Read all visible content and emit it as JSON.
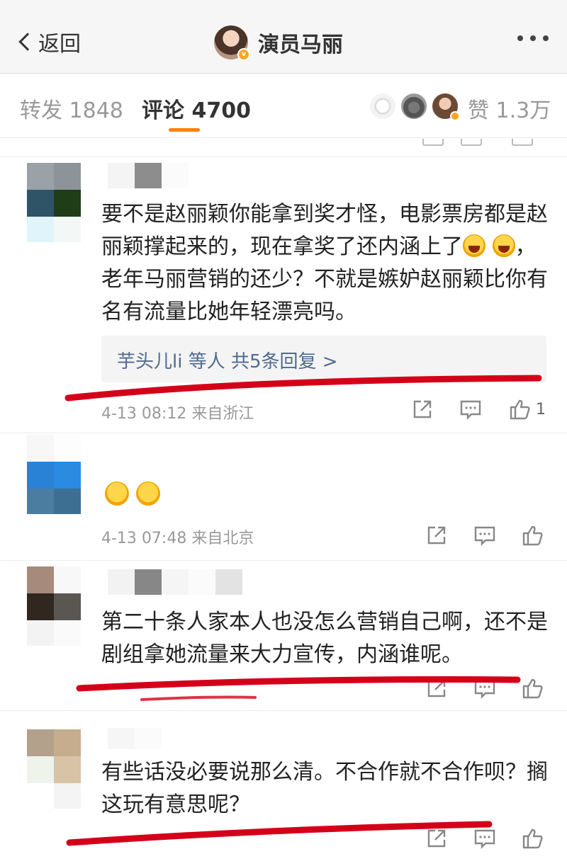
{
  "header": {
    "back_label": "返回",
    "title": "演员马丽",
    "verified_badge": "v"
  },
  "tabs": {
    "repost_label": "转发 1848",
    "comment_label": "评论 4700",
    "likes_label": "赞 1.3万"
  },
  "comments": [
    {
      "text_parts": [
        "要不是赵丽颖你能拿到奖才怪，电影票房都是赵丽颖撑起来的，现在拿奖了还内涵上了",
        "，老年马丽营销的还少？不就是嫉妒赵丽颖比你有名有流量比她年轻漂亮吗。"
      ],
      "replies_label": "芋头儿li 等人  共5条回复 >",
      "meta": "4-13 08:12 来自浙江",
      "like_count": "1"
    },
    {
      "meta": "4-13 07:48 来自北京"
    },
    {
      "text": "第二十条人家本人也没怎么营销自己啊，还不是剧组拿她流量来大力宣传，内涵谁呢。"
    },
    {
      "text": "有些话没必要说那么清。不合作就不合作呗？搁这玩有意思呢？"
    }
  ],
  "colors": {
    "accent": "#ff8200",
    "underline_mark": "#d4001a",
    "reply_link": "#506a8f"
  }
}
